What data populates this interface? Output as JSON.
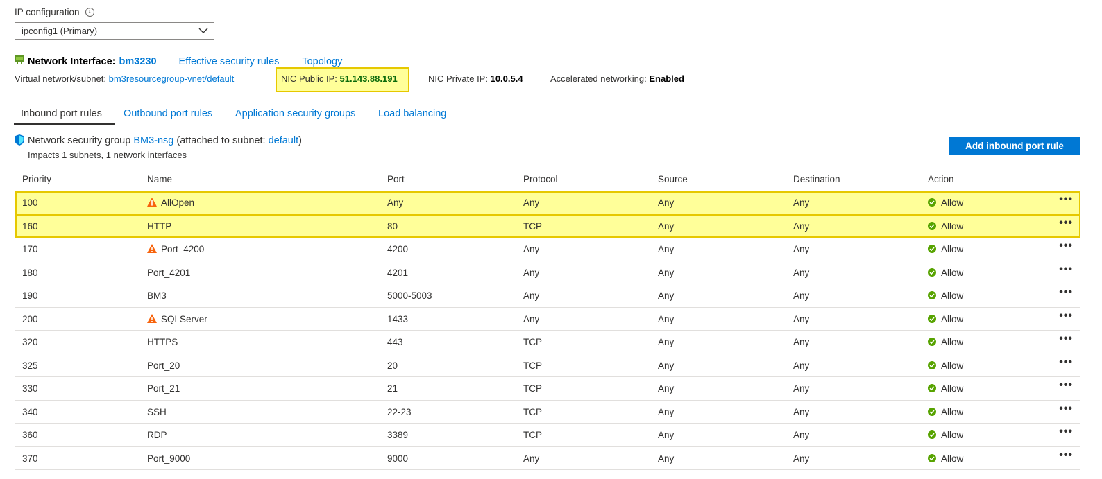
{
  "ip_config": {
    "label": "IP configuration",
    "info_glyph": "i",
    "selected": "ipconfig1 (Primary)"
  },
  "nic": {
    "title": "Network Interface:",
    "name": "bm3230",
    "effective_link": "Effective security rules",
    "topology_link": "Topology",
    "vnet_label": "Virtual network/subnet:",
    "vnet_value": "bm3resourcegroup-vnet/default",
    "public_ip_label": "NIC Public IP:",
    "public_ip_value": "51.143.88.191",
    "private_ip_label": "NIC Private IP:",
    "private_ip_value": "10.0.5.4",
    "accel_label": "Accelerated networking:",
    "accel_value": "Enabled"
  },
  "tabs": [
    "Inbound port rules",
    "Outbound port rules",
    "Application security groups",
    "Load balancing"
  ],
  "nsg": {
    "prefix": "Network security group",
    "name": "BM3-nsg",
    "mid": "(attached to subnet:",
    "subnet": "default",
    "suffix": ")",
    "impacts": "Impacts 1 subnets, 1 network interfaces"
  },
  "add_button": "Add inbound port rule",
  "table": {
    "headers": [
      "Priority",
      "Name",
      "Port",
      "Protocol",
      "Source",
      "Destination",
      "Action"
    ],
    "rows": [
      {
        "priority": "100",
        "name": "AllOpen",
        "warn": true,
        "port": "Any",
        "protocol": "Any",
        "source": "Any",
        "destination": "Any",
        "action": "Allow",
        "highlight": true
      },
      {
        "priority": "160",
        "name": "HTTP",
        "warn": false,
        "port": "80",
        "protocol": "TCP",
        "source": "Any",
        "destination": "Any",
        "action": "Allow",
        "highlight": true
      },
      {
        "priority": "170",
        "name": "Port_4200",
        "warn": true,
        "port": "4200",
        "protocol": "Any",
        "source": "Any",
        "destination": "Any",
        "action": "Allow",
        "highlight": false
      },
      {
        "priority": "180",
        "name": "Port_4201",
        "warn": false,
        "port": "4201",
        "protocol": "Any",
        "source": "Any",
        "destination": "Any",
        "action": "Allow",
        "highlight": false
      },
      {
        "priority": "190",
        "name": "BM3",
        "warn": false,
        "port": "5000-5003",
        "protocol": "Any",
        "source": "Any",
        "destination": "Any",
        "action": "Allow",
        "highlight": false
      },
      {
        "priority": "200",
        "name": "SQLServer",
        "warn": true,
        "port": "1433",
        "protocol": "Any",
        "source": "Any",
        "destination": "Any",
        "action": "Allow",
        "highlight": false
      },
      {
        "priority": "320",
        "name": "HTTPS",
        "warn": false,
        "port": "443",
        "protocol": "TCP",
        "source": "Any",
        "destination": "Any",
        "action": "Allow",
        "highlight": false
      },
      {
        "priority": "325",
        "name": "Port_20",
        "warn": false,
        "port": "20",
        "protocol": "TCP",
        "source": "Any",
        "destination": "Any",
        "action": "Allow",
        "highlight": false
      },
      {
        "priority": "330",
        "name": "Port_21",
        "warn": false,
        "port": "21",
        "protocol": "TCP",
        "source": "Any",
        "destination": "Any",
        "action": "Allow",
        "highlight": false
      },
      {
        "priority": "340",
        "name": "SSH",
        "warn": false,
        "port": "22-23",
        "protocol": "TCP",
        "source": "Any",
        "destination": "Any",
        "action": "Allow",
        "highlight": false
      },
      {
        "priority": "360",
        "name": "RDP",
        "warn": false,
        "port": "3389",
        "protocol": "TCP",
        "source": "Any",
        "destination": "Any",
        "action": "Allow",
        "highlight": false
      },
      {
        "priority": "370",
        "name": "Port_9000",
        "warn": false,
        "port": "9000",
        "protocol": "Any",
        "source": "Any",
        "destination": "Any",
        "action": "Allow",
        "highlight": false
      }
    ],
    "more_glyph": "•••"
  },
  "colors": {
    "link": "#0078d4",
    "highlight": "#ffff99",
    "highlight_border": "#e6c800",
    "allow_green": "#57a300",
    "warning_orange": "#f7630c",
    "public_ip_green": "#0b6a0b"
  },
  "icons": {
    "info": "info-icon",
    "nic": "network-interface-icon",
    "shield": "shield-icon",
    "warning": "warning-icon",
    "allow": "check-circle-icon",
    "more": "more-icon",
    "dropdown": "chevron-down-icon"
  }
}
